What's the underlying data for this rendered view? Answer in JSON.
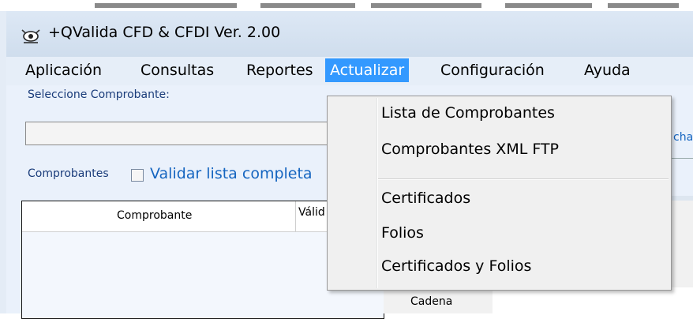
{
  "window": {
    "title": "+QValida CFD & CFDI Ver. 2.00"
  },
  "menubar": {
    "items": [
      {
        "label": "Aplicación"
      },
      {
        "label": "Consultas"
      },
      {
        "label": "Reportes"
      },
      {
        "label": "Actualizar"
      },
      {
        "label": "Configuración"
      },
      {
        "label": "Ayuda"
      }
    ],
    "active": "Actualizar"
  },
  "form": {
    "select_label": "Seleccione Comprobante:",
    "comprobantes_label": "Comprobantes",
    "validate_all_label": "Validar lista completa",
    "validate_all_checked": false,
    "right_partial_link": "cha",
    "cadena_label": "Cadena"
  },
  "grid": {
    "columns": [
      "Comprobante",
      "Válid"
    ]
  },
  "dropdown": {
    "items": [
      {
        "label": "Lista de Comprobantes"
      },
      {
        "label": "Comprobantes XML FTP"
      },
      {
        "label": "Certificados"
      },
      {
        "label": "Folios"
      },
      {
        "label": "Certificados y Folios"
      }
    ]
  },
  "colors": {
    "accent": "#3399ff",
    "link": "#1565c0",
    "window_bg": "#e4ecf6"
  },
  "icons": {
    "app": "app-eye-icon"
  }
}
